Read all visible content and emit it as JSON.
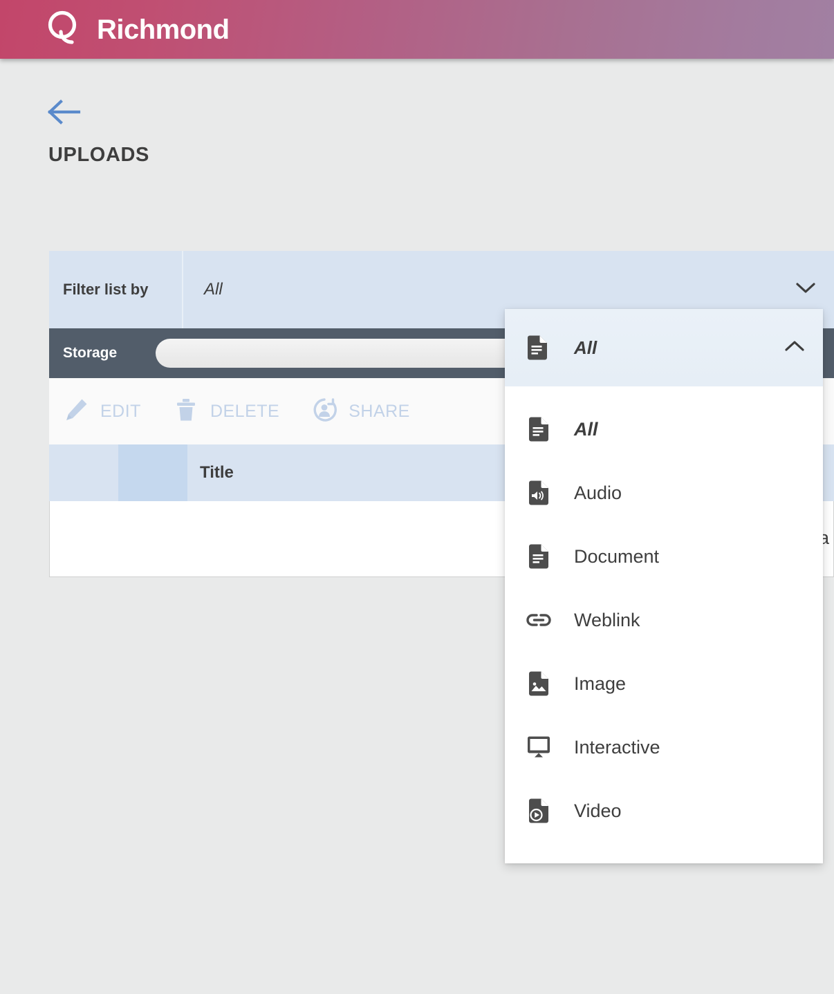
{
  "header": {
    "brand_name": "Richmond",
    "logo_icon": "richmond-r-logo",
    "gradient_start": "#c2466a",
    "gradient_end": "#a180a2"
  },
  "page": {
    "back_icon": "arrow-left-icon",
    "title": "UPLOADS",
    "background": "#e9eaea"
  },
  "filter": {
    "label": "Filter list by",
    "value": "All",
    "chevron_icon": "chevron-down-icon",
    "background": "#d8e3f1"
  },
  "storage": {
    "label": "Storage",
    "bar_icon": "progress-bar",
    "background": "#525d6a"
  },
  "actions": [
    {
      "label": "EDIT",
      "icon": "pencil-icon"
    },
    {
      "label": "DELETE",
      "icon": "trash-icon"
    },
    {
      "label": "SHARE",
      "icon": "person-share-icon"
    }
  ],
  "action_color": "#c2d2e8",
  "table": {
    "columns": [
      "",
      "",
      "Title"
    ],
    "row_partial_text": "a"
  },
  "dropdown": {
    "selected": {
      "label": "All",
      "icon": "document-icon"
    },
    "chevron_icon": "chevron-up-icon",
    "options": [
      {
        "label": "All",
        "icon": "document-icon",
        "italic": true
      },
      {
        "label": "Audio",
        "icon": "audio-file-icon",
        "italic": false
      },
      {
        "label": "Document",
        "icon": "document-icon",
        "italic": false
      },
      {
        "label": "Weblink",
        "icon": "link-icon",
        "italic": false
      },
      {
        "label": "Image",
        "icon": "image-file-icon",
        "italic": false
      },
      {
        "label": "Interactive",
        "icon": "monitor-icon",
        "italic": false
      },
      {
        "label": "Video",
        "icon": "video-file-icon",
        "italic": false
      }
    ]
  }
}
